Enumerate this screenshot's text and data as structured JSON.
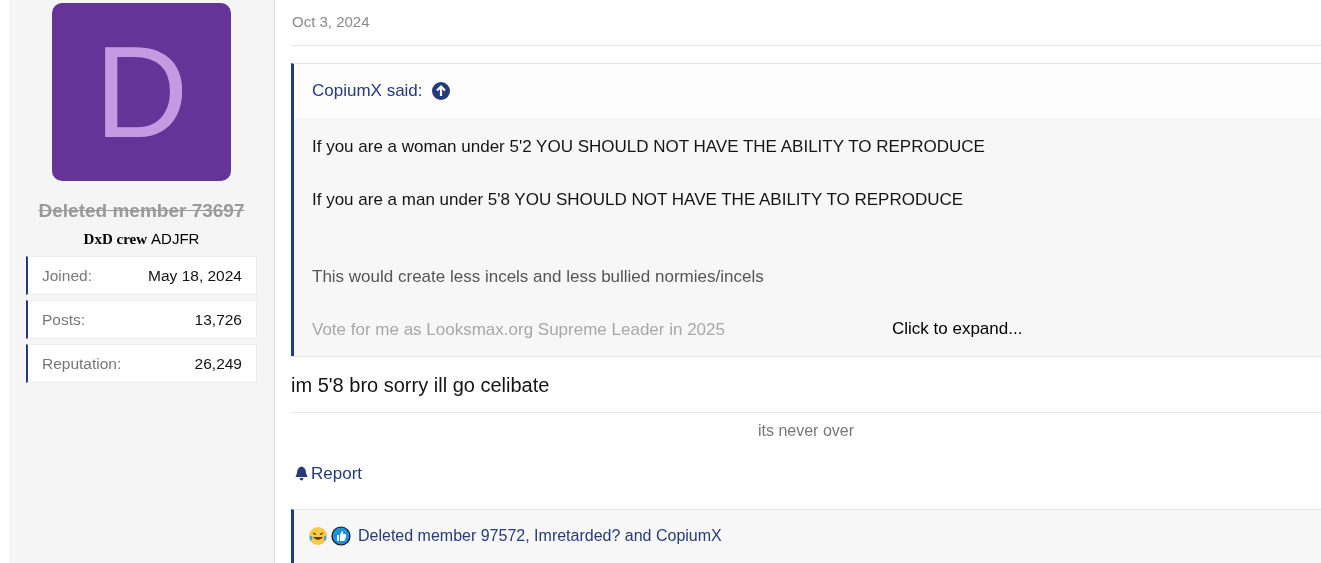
{
  "user": {
    "avatar_letter": "D",
    "name": "Deleted member 73697",
    "deleted": true,
    "banner": "DxD crew",
    "title": "ADJFR",
    "stats": [
      {
        "label": "Joined:",
        "value": "May 18, 2024"
      },
      {
        "label": "Posts:",
        "value": "13,726"
      },
      {
        "label": "Reputation:",
        "value": "26,249"
      }
    ]
  },
  "post": {
    "date": "Oct 3, 2024",
    "quote": {
      "author": "CopiumX said:",
      "lines": [
        {
          "text": "If you are a woman under 5'2 YOU SHOULD NOT HAVE THE ABILITY TO REPRODUCE",
          "kind": "plain"
        },
        {
          "text": "If you are a man under 5'8 YOU SHOULD NOT HAVE THE ABILITY TO REPRODUCE",
          "kind": "plain"
        },
        {
          "text": "This would create less incels and less bullied normies/incels",
          "kind": "muted"
        },
        {
          "text": "Vote for me as Looksmax.org Supreme Leader in 2025",
          "kind": "faded"
        }
      ],
      "expand": "Click to expand..."
    },
    "message": "im 5'8 bro sorry ill go celibate",
    "signature": "its never over",
    "report": "Report",
    "reactions": {
      "icons": [
        {
          "kind": "laugh"
        },
        {
          "kind": "like"
        }
      ],
      "users": "Deleted member 97572, Imretarded? and CopiumX"
    }
  }
}
